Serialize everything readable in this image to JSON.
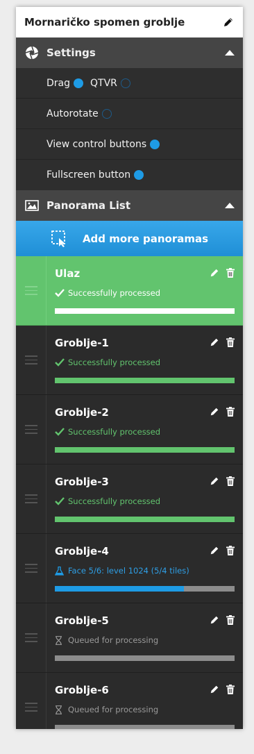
{
  "header": {
    "title": "Mornaričko spomen groblje"
  },
  "settings": {
    "label": "Settings",
    "drag_label": "Drag",
    "drag_on": true,
    "qtvr_label": "QTVR",
    "qtvr_on": false,
    "autorotate_label": "Autorotate",
    "autorotate_on": false,
    "view_controls_label": "View control buttons",
    "view_controls_on": true,
    "fullscreen_label": "Fullscreen button",
    "fullscreen_on": true
  },
  "panorama_list": {
    "label": "Panorama List",
    "add_button_label": "Add more panoramas",
    "items": [
      {
        "name": "Ulaz",
        "status": "Successfully processed",
        "status_type": "done",
        "progress": 1.0,
        "active": true
      },
      {
        "name": "Groblje-1",
        "status": "Successfully processed",
        "status_type": "done",
        "progress": 1.0,
        "active": false
      },
      {
        "name": "Groblje-2",
        "status": "Successfully processed",
        "status_type": "done",
        "progress": 1.0,
        "active": false
      },
      {
        "name": "Groblje-3",
        "status": "Successfully processed",
        "status_type": "done",
        "progress": 1.0,
        "active": false
      },
      {
        "name": "Groblje-4",
        "status": "Face 5/6: level 1024 (5/4 tiles)",
        "status_type": "processing",
        "progress": 0.72,
        "active": false
      },
      {
        "name": "Groblje-5",
        "status": "Queued for processing",
        "status_type": "queued",
        "progress": 0.0,
        "active": false
      },
      {
        "name": "Groblje-6",
        "status": "Queued for processing",
        "status_type": "queued",
        "progress": 0.0,
        "active": false
      }
    ]
  },
  "colors": {
    "accent_blue": "#1e9be5",
    "success_green": "#62c46e",
    "panel_dark": "#2b2b2b",
    "header_gray": "#454545"
  }
}
